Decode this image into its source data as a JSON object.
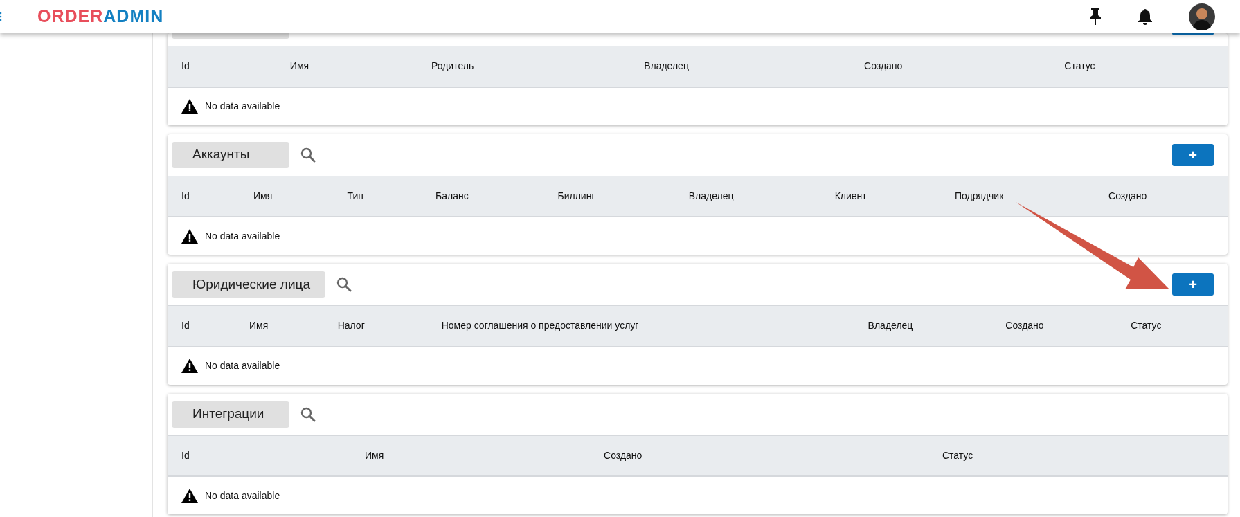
{
  "header": {
    "logo": [
      "ORDER",
      "ADMIN"
    ]
  },
  "sections": [
    {
      "has_add_button": true,
      "columns": [
        "Id",
        "Имя",
        "Родитель",
        "Владелец",
        "Создано",
        "Статус"
      ],
      "empty_text": "No data available"
    },
    {
      "title": "Аккаунты",
      "has_add_button": true,
      "add_label": "+",
      "columns": [
        "Id",
        "Имя",
        "Тип",
        "Баланс",
        "Биллинг",
        "Владелец",
        "Клиент",
        "Подрядчик",
        "Создано"
      ],
      "empty_text": "No data available"
    },
    {
      "title": "Юридические лица",
      "has_add_button": true,
      "add_label": "+",
      "columns": [
        "Id",
        "Имя",
        "Налог",
        "Номер соглашения о предоставлении услуг",
        "Владелец",
        "Создано",
        "Статус"
      ],
      "empty_text": "No data available"
    },
    {
      "title": "Интеграции",
      "has_add_button": false,
      "columns": [
        "Id",
        "Имя",
        "Создано",
        "Статус"
      ],
      "empty_text": "No data available"
    }
  ]
}
